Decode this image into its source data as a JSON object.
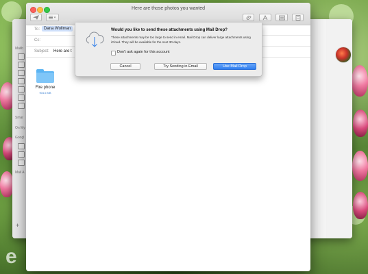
{
  "compose": {
    "window_title": "Here are those photos you wanted",
    "to_label": "To:",
    "to_value": "Dana Wollman",
    "cc_label": "Cc:",
    "subject_label": "Subject:",
    "subject_value": "Here are t",
    "attachment": {
      "name": "Fire phone",
      "size": "904.6 MB"
    }
  },
  "sidebar": {
    "mailboxes_label": "Mailb",
    "smart_label": "Smar",
    "on_my_mac_label": "On My",
    "google_label": "Googl",
    "mail_activity_label": "Mail A"
  },
  "dialog": {
    "title": "Would you like to send these attachments using Mail Drop?",
    "body": "These attachments may be too large to send in email. Mail Drop can deliver large attachments using iCloud. They will be available for the next 30 days.",
    "checkbox_label": "Don't ask again for this account",
    "cancel_label": "Cancel",
    "try_email_label": "Try Sending in Email",
    "use_mail_drop_label": "Use Mail Drop"
  },
  "icons": [
    "cloud-download-icon",
    "folder-icon",
    "send-icon",
    "format-icon",
    "attachment-icon",
    "photo-browser-icon",
    "contact-avatar"
  ],
  "colors": {
    "accent": "#2f7ff0",
    "selection": "#cfe0fb",
    "folder": "#7fc6f8"
  },
  "watermark": "e"
}
